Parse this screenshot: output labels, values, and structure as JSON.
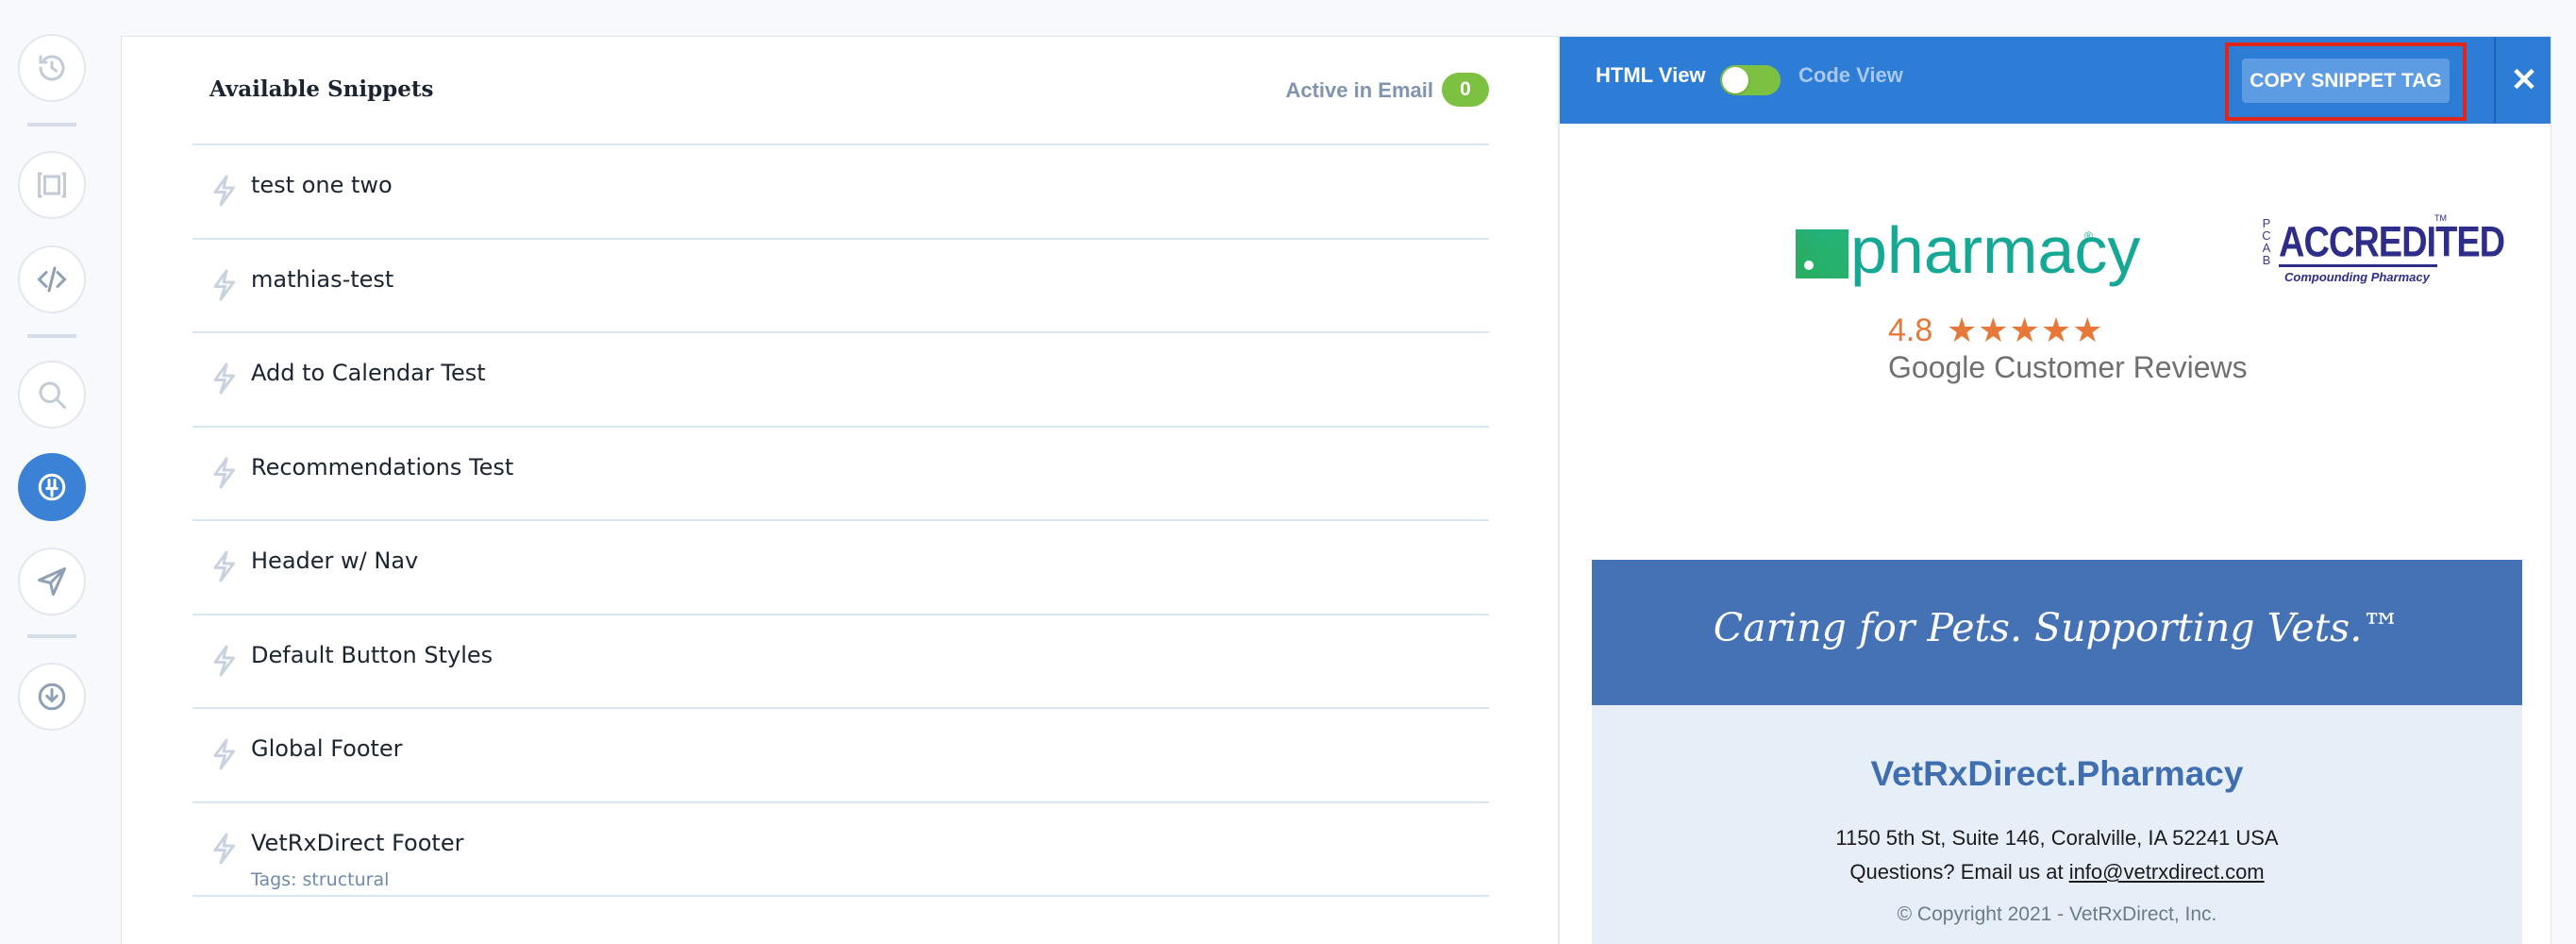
{
  "rail": {
    "items": [
      {
        "name": "history-icon"
      },
      {
        "name": "layout-icon"
      },
      {
        "name": "code-icon"
      },
      {
        "name": "search-icon"
      },
      {
        "name": "snippets-icon",
        "active": true
      },
      {
        "name": "send-icon"
      },
      {
        "name": "download-icon"
      }
    ]
  },
  "snippets": {
    "title": "Available Snippets",
    "active_label": "Active in Email",
    "active_count": "0",
    "items": [
      {
        "name": "test one two"
      },
      {
        "name": "mathias-test"
      },
      {
        "name": "Add to Calendar Test"
      },
      {
        "name": "Recommendations Test"
      },
      {
        "name": "Header w/ Nav"
      },
      {
        "name": "Default Button Styles"
      },
      {
        "name": "Global Footer"
      },
      {
        "name": "VetRxDirect Footer",
        "tags": "Tags: structural"
      }
    ]
  },
  "preview": {
    "html_view_label": "HTML View",
    "code_view_label": "Code View",
    "copy_button_label": "COPY SNIPPET TAG",
    "close_label": "✕",
    "colors": {
      "bar": "#2d7cd6",
      "toggle_on": "#7cc142",
      "highlight": "#e0251b"
    },
    "email": {
      "logo_word": "pharmacy",
      "logo_tm": "®",
      "pcab_side": "P C A B",
      "pcab_word": "ACCREDITED",
      "pcab_sub": "Compounding Pharmacy",
      "pcab_tm": "TM",
      "rating": "4.8",
      "stars": "★★★★★",
      "review_text": "Google Customer Reviews",
      "tagline": "Caring for Pets. Supporting Vets.™",
      "brand": "VetRxDirect.Pharmacy",
      "address": "1150 5th St, Suite 146, Coralville, IA 52241 USA",
      "questions_prefix": "Questions? Email us at ",
      "email_link": "info@vetrxdirect.com",
      "copyright": "© Copyright 2021 - VetRxDirect, Inc."
    }
  }
}
